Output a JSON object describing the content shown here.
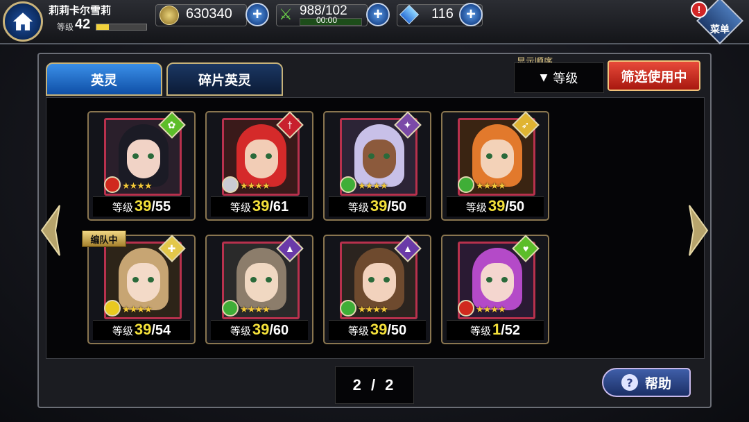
{
  "player": {
    "name": "莉莉卡尔雪莉",
    "level_label": "等级",
    "level": "42",
    "xp_fraction": 0.25
  },
  "resources": {
    "gold": "630340",
    "stamina": "988/102",
    "stamina_timer": "00:00",
    "gems": "116"
  },
  "menu": {
    "label": "菜单"
  },
  "tabs": [
    {
      "label": "英灵"
    },
    {
      "label": "碎片英灵"
    }
  ],
  "sort": {
    "heading": "显示顺序",
    "value": "等级"
  },
  "filter": {
    "label": "筛选使用中"
  },
  "units": [
    {
      "level_label": "等级",
      "level": "39",
      "max": "/55",
      "element_color": "#d0291e",
      "class_color": "#5cbd2a",
      "class_icon": "✿",
      "portrait": "#2a1f2b",
      "hair": "#1b1b25",
      "skin": "#f1d3c6"
    },
    {
      "level_label": "等级",
      "level": "39",
      "max": "/61",
      "element_color": "#c9ccd4",
      "class_color": "#c8202d",
      "class_icon": "†",
      "portrait": "#3a1a1a",
      "hair": "#d52a2a",
      "skin": "#f2cdb6"
    },
    {
      "level_label": "等级",
      "level": "39",
      "max": "/50",
      "element_color": "#3fae37",
      "class_color": "#7b4aa8",
      "class_icon": "✦",
      "portrait": "#2c2436",
      "hair": "#c8c0e8",
      "skin": "#8c5a3c"
    },
    {
      "level_label": "等级",
      "level": "39",
      "max": "/50",
      "element_color": "#3fae37",
      "class_color": "#e0b432",
      "class_icon": "➶",
      "portrait": "#3a2412",
      "hair": "#e2792c",
      "skin": "#f3d2b8"
    },
    {
      "level_label": "等级",
      "level": "39",
      "max": "/54",
      "element_color": "#e9c91f",
      "class_color": "#e3c84a",
      "class_icon": "✚",
      "portrait": "#2d2418",
      "hair": "#c7a573",
      "skin": "#f3dac8",
      "badge": "编队中"
    },
    {
      "level_label": "等级",
      "level": "39",
      "max": "/60",
      "element_color": "#3fae37",
      "class_color": "#6a3aa8",
      "class_icon": "▲",
      "portrait": "#2a2a2a",
      "hair": "#8c7d6b",
      "skin": "#f0d8c2"
    },
    {
      "level_label": "等级",
      "level": "39",
      "max": "/50",
      "element_color": "#3fae37",
      "class_color": "#6a3aa8",
      "class_icon": "▲",
      "portrait": "#2b241f",
      "hair": "#6e4a2e",
      "skin": "#f2d2bd"
    },
    {
      "level_label": "等级",
      "level": "1",
      "max": "/52",
      "element_color": "#d0291e",
      "class_color": "#5cbd2a",
      "class_icon": "♥",
      "portrait": "#2a1a33",
      "hair": "#b44ac8",
      "skin": "#f4d6cf"
    }
  ],
  "pager": {
    "text": "2 / 2"
  },
  "help": {
    "label": "帮助"
  }
}
